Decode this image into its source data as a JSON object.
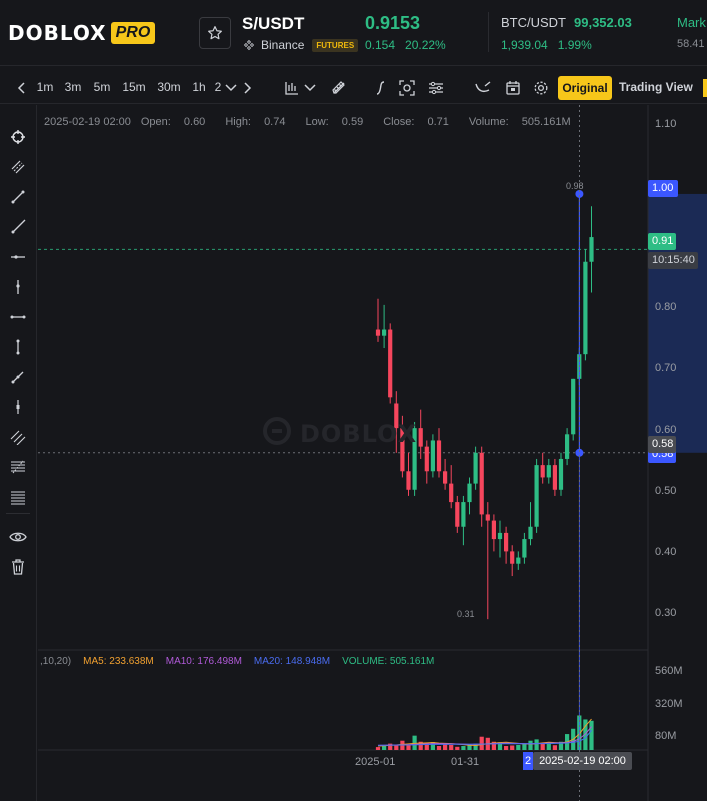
{
  "header": {
    "logo_text": "DOBLOX",
    "logo_badge": "PRO",
    "pair": "S/USDT",
    "exchange": "Binance",
    "market_badge": "FUTURES",
    "last_price": "0.9153",
    "change_abs": "0.154",
    "change_pct": "20.22%",
    "ticker_pair": "BTC/USDT",
    "ticker_price": "99,352.03",
    "ticker_change_abs": "1,939.04",
    "ticker_change_pct": "1.99%",
    "mark_label": "Mark",
    "mark_value": "58.41",
    "up_color": "#2ebd85",
    "down_color": "#f6465d",
    "brand_color": "#f7c71a"
  },
  "toolbar": {
    "intervals": [
      "1m",
      "3m",
      "5m",
      "15m",
      "30m",
      "1h",
      "2"
    ],
    "original_label": "Original",
    "tradingview_label": "Trading View",
    "icons": [
      "chevron-left-icon",
      "chevron-down-icon",
      "chevron-right-icon",
      "candle-type-icon",
      "chevron-down-icon",
      "ruler-icon",
      "indicator-fx-icon",
      "screenshot-icon",
      "settings-sliders-icon",
      "draw-icon",
      "calendar-icon",
      "gear-icon"
    ]
  },
  "left_tools": {
    "icons": [
      "crosshair-icon",
      "parallel-lines-icon",
      "trend-line-icon",
      "ray-icon",
      "horizontal-line-icon",
      "vertical-line-icon",
      "horizontal-range-icon",
      "vertical-range-icon",
      "arrow-line-icon",
      "price-marker-icon",
      "fib-channel-icon",
      "fib-retracement-icon",
      "fib-extension-icon",
      "eye-icon",
      "trash-icon"
    ]
  },
  "legend": {
    "date": "2025-02-19 02:00",
    "open_label": "Open:",
    "open": "0.60",
    "high_label": "High:",
    "high": "0.74",
    "low_label": "Low:",
    "low": "0.59",
    "close_label": "Close:",
    "close": "0.71",
    "volume_label": "Volume:",
    "volume": "505.161M"
  },
  "ma_legend": {
    "prefix": ",10,20)",
    "ma5": "MA5: 233.638M",
    "ma10": "MA10: 176.498M",
    "ma20": "MA20: 148.948M",
    "volume": "VOLUME: 505.161M",
    "ma5_color": "#f0a030",
    "ma10_color": "#b05ad8",
    "ma20_color": "#4a6cf0",
    "volume_color": "#2ebd85"
  },
  "price_axis": {
    "labels": [
      "1.10",
      "0.80",
      "0.70",
      "0.60",
      "0.50",
      "0.40",
      "0.30"
    ]
  },
  "volume_axis": {
    "labels": [
      "560M",
      "320M",
      "80M"
    ]
  },
  "time_axis": {
    "labels": [
      "2025-01",
      "01-31"
    ],
    "crosshair_time": "2025-02-19 02:00",
    "crosshair_prefix": "2"
  },
  "price_tags": {
    "range_top": "1.00",
    "current": "0.91",
    "countdown": "10:15:40",
    "crosshair": "0.58",
    "range_bottom": "0.58"
  },
  "annotations": {
    "low_marker": "0.31",
    "high_marker": "0.98"
  },
  "watermark": "DOBLOX",
  "chart_data": {
    "type": "candlestick",
    "ylim": [
      0.26,
      1.12
    ],
    "candles": [
      [
        0.78,
        0.83,
        0.76,
        0.77
      ],
      [
        0.77,
        0.82,
        0.75,
        0.78
      ],
      [
        0.78,
        0.79,
        0.66,
        0.67
      ],
      [
        0.66,
        0.68,
        0.58,
        0.62
      ],
      [
        0.62,
        0.64,
        0.54,
        0.55
      ],
      [
        0.55,
        0.58,
        0.51,
        0.52
      ],
      [
        0.52,
        0.63,
        0.51,
        0.62
      ],
      [
        0.62,
        0.65,
        0.57,
        0.59
      ],
      [
        0.59,
        0.6,
        0.53,
        0.55
      ],
      [
        0.55,
        0.61,
        0.54,
        0.6
      ],
      [
        0.6,
        0.62,
        0.54,
        0.55
      ],
      [
        0.55,
        0.57,
        0.52,
        0.53
      ],
      [
        0.53,
        0.56,
        0.49,
        0.5
      ],
      [
        0.5,
        0.51,
        0.45,
        0.46
      ],
      [
        0.46,
        0.51,
        0.43,
        0.5
      ],
      [
        0.5,
        0.54,
        0.48,
        0.53
      ],
      [
        0.53,
        0.59,
        0.52,
        0.58
      ],
      [
        0.58,
        0.59,
        0.46,
        0.48
      ],
      [
        0.48,
        0.5,
        0.31,
        0.47
      ],
      [
        0.47,
        0.48,
        0.42,
        0.44
      ],
      [
        0.44,
        0.47,
        0.41,
        0.45
      ],
      [
        0.45,
        0.46,
        0.4,
        0.42
      ],
      [
        0.42,
        0.43,
        0.38,
        0.4
      ],
      [
        0.4,
        0.42,
        0.39,
        0.41
      ],
      [
        0.41,
        0.45,
        0.4,
        0.44
      ],
      [
        0.44,
        0.5,
        0.43,
        0.46
      ],
      [
        0.46,
        0.57,
        0.45,
        0.56
      ],
      [
        0.56,
        0.58,
        0.53,
        0.54
      ],
      [
        0.54,
        0.57,
        0.53,
        0.56
      ],
      [
        0.56,
        0.57,
        0.51,
        0.52
      ],
      [
        0.52,
        0.58,
        0.51,
        0.57
      ],
      [
        0.57,
        0.62,
        0.56,
        0.61
      ],
      [
        0.61,
        0.7,
        0.6,
        0.7
      ],
      [
        0.7,
        0.75,
        0.69,
        0.74
      ],
      [
        0.74,
        0.91,
        0.73,
        0.89
      ],
      [
        0.89,
        0.98,
        0.84,
        0.93
      ]
    ],
    "volumes_m": [
      22,
      30,
      48,
      36,
      70,
      40,
      108,
      62,
      52,
      60,
      30,
      42,
      38,
      24,
      30,
      42,
      48,
      100,
      92,
      62,
      58,
      30,
      34,
      38,
      50,
      70,
      80,
      48,
      56,
      36,
      62,
      120,
      160,
      260,
      230,
      220
    ],
    "ma5_m": [
      30,
      32,
      36,
      38,
      42,
      46,
      50,
      52,
      54,
      56,
      52,
      50,
      48,
      44,
      40,
      36,
      34,
      40,
      48,
      52,
      56,
      58,
      54,
      50,
      46,
      44,
      48,
      54,
      58,
      56,
      54,
      60,
      80,
      120,
      180,
      233
    ],
    "ma10_m": [
      34,
      36,
      37,
      38,
      39,
      40,
      42,
      44,
      46,
      48,
      48,
      47,
      46,
      45,
      44,
      42,
      42,
      44,
      46,
      48,
      50,
      51,
      50,
      49,
      48,
      47,
      48,
      50,
      52,
      53,
      54,
      56,
      64,
      84,
      120,
      176
    ],
    "ma20_m": [
      36,
      36,
      37,
      37,
      38,
      38,
      39,
      40,
      41,
      42,
      42,
      42,
      43,
      43,
      43,
      43,
      44,
      44,
      45,
      46,
      47,
      47,
      47,
      47,
      47,
      47,
      48,
      48,
      49,
      50,
      51,
      53,
      57,
      66,
      90,
      149
    ],
    "volume_ylim": [
      0,
      640
    ],
    "current_price": 0.91,
    "crosshair_price": 0.58,
    "range_tool": [
      0.58,
      1.0
    ]
  }
}
